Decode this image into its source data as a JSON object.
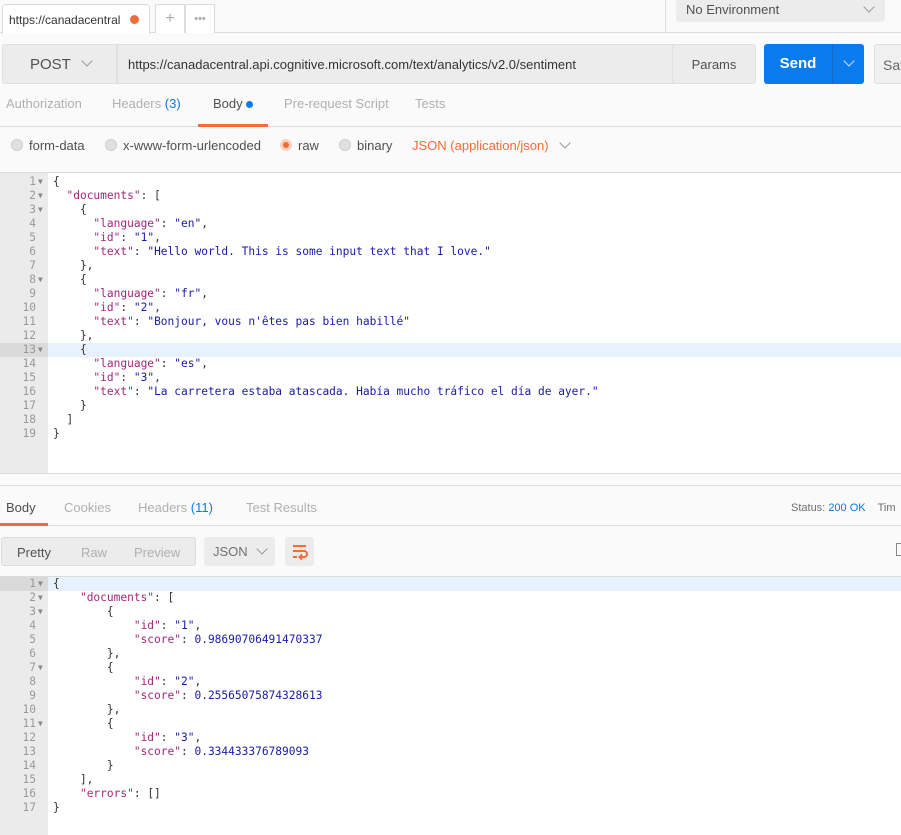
{
  "tabs": {
    "request_tab": "https://canadacentral",
    "new_tab": "+",
    "more": "•••"
  },
  "environment": {
    "selected": "No Environment"
  },
  "request": {
    "method": "POST",
    "url": "https://canadacentral.api.cognitive.microsoft.com/text/analytics/v2.0/sentiment",
    "params_label": "Params",
    "send_label": "Send",
    "save_label": "Sav"
  },
  "request_tabs": [
    {
      "label": "Authorization"
    },
    {
      "label": "Headers",
      "count": "(3)"
    },
    {
      "label": "Body"
    },
    {
      "label": "Pre-request Script"
    },
    {
      "label": "Tests"
    }
  ],
  "body_types": {
    "options": [
      "form-data",
      "x-www-form-urlencoded",
      "raw",
      "binary"
    ],
    "selected": "raw",
    "content_type": "JSON (application/json)"
  },
  "request_body": {
    "highlight_line": 13,
    "fold_lines": [
      1,
      2,
      3,
      8,
      13
    ],
    "lines": [
      "{",
      "  \"documents\": [",
      "    {",
      "      \"language\": \"en\",",
      "      \"id\": \"1\",",
      "      \"text\": \"Hello world. This is some input text that I love.\"",
      "    },",
      "    {",
      "      \"language\": \"fr\",",
      "      \"id\": \"2\",",
      "      \"text\": \"Bonjour, vous n'êtes pas bien habillé\"",
      "    },",
      "    {",
      "      \"language\": \"es\",",
      "      \"id\": \"3\",",
      "      \"text\": \"La carretera estaba atascada. Había mucho tráfico el día de ayer.\"",
      "    }",
      "  ]",
      "}"
    ]
  },
  "response_tabs": [
    {
      "label": "Body"
    },
    {
      "label": "Cookies"
    },
    {
      "label": "Headers",
      "count": "(11)"
    },
    {
      "label": "Test Results"
    }
  ],
  "status": {
    "label": "Status:",
    "value": "200 OK",
    "time_label": "Tim"
  },
  "view_modes": [
    "Pretty",
    "Raw",
    "Preview"
  ],
  "format": "JSON",
  "colors": {
    "accent": "#f26b3a",
    "send": "#097bed"
  },
  "response_body": {
    "highlight_line": 1,
    "fold_lines": [
      1,
      2,
      3,
      7,
      11
    ],
    "lines": [
      "{",
      "    \"documents\": [",
      "        {",
      "            \"id\": \"1\",",
      "            \"score\": 0.98690706491470337",
      "        },",
      "        {",
      "            \"id\": \"2\",",
      "            \"score\": 0.25565075874328613",
      "        },",
      "        {",
      "            \"id\": \"3\",",
      "            \"score\": 0.334433376789093",
      "        }",
      "    ],",
      "    \"errors\": []",
      "}"
    ]
  }
}
